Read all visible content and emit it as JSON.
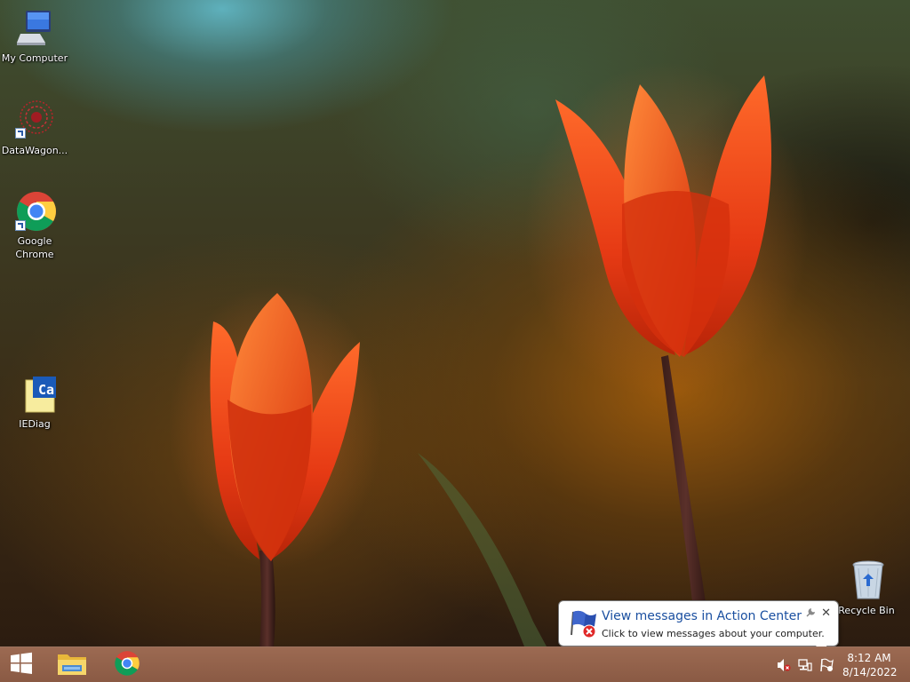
{
  "desktop": {
    "icons": [
      {
        "label": "My Computer",
        "icon": "computer-icon"
      },
      {
        "label": "DataWagon...",
        "icon": "datawagon-icon"
      },
      {
        "label": "Google Chrome",
        "icon": "chrome-icon"
      },
      {
        "label": "IEDiag",
        "icon": "iediag-folder-icon"
      },
      {
        "label": "Recycle Bin",
        "icon": "recycle-bin-icon"
      }
    ]
  },
  "notification": {
    "title": "View messages in Action Center",
    "message": "Click to view messages about your computer.",
    "close_glyph": "✕",
    "options_glyph": "🔧"
  },
  "taskbar": {
    "pinned": [
      {
        "icon": "start-windows-icon"
      },
      {
        "icon": "file-explorer-icon"
      },
      {
        "icon": "chrome-icon"
      }
    ],
    "tray": {
      "icons": [
        "speaker-muted-icon",
        "network-icon",
        "action-center-flag-icon"
      ],
      "time": "8:12 AM",
      "date": "8/14/2022"
    }
  },
  "colors": {
    "taskbar": "#8a5a44",
    "balloon_title": "#1a4fa0",
    "tulip": "#e8401c"
  }
}
